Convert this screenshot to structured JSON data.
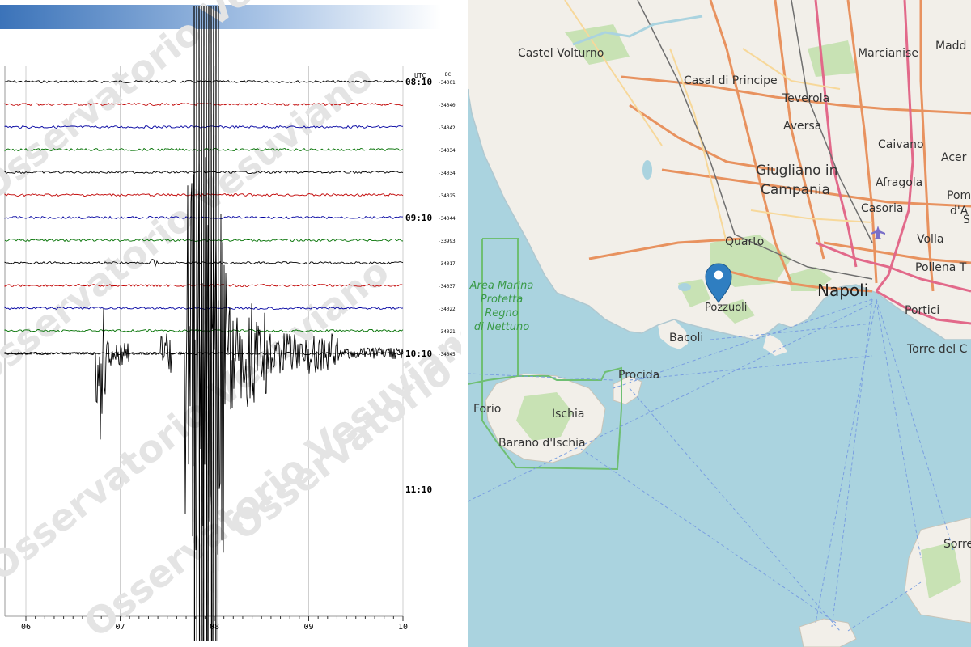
{
  "seismogram": {
    "utc_label": "UTC",
    "dc_label": "DC",
    "hour_labels": [
      "08:10",
      "09:10",
      "10:10",
      "11:10"
    ],
    "x_ticks": [
      "06",
      "07",
      "08",
      "09",
      "10"
    ],
    "dc_values": [
      "-34001",
      "-34040",
      "-34042",
      "-34034",
      "-34034",
      "-34025",
      "-34044",
      "-33993",
      "-34017",
      "-34037",
      "-34022",
      "-34021",
      "-34045"
    ],
    "trace_colors": [
      "#000000",
      "#c00000",
      "#0000a0",
      "#007000"
    ],
    "watermark": "Osservatorio Vesuviano"
  },
  "map": {
    "places": [
      "Castel Volturno",
      "Marcianise",
      "Madd",
      "Casal di Principe",
      "Teverola",
      "Aversa",
      "Caivano",
      "Acer",
      "Giugliano in",
      "Campania",
      "Afragola",
      "Pomi",
      "d'A",
      "Casoria",
      "Quarto",
      "Volla",
      "Pollena T",
      "Napoli",
      "Pozzuoli",
      "Portici",
      "Bacoli",
      "Torre del C",
      "Procida",
      "Forio",
      "Ischia",
      "Barano d'Ischia",
      "Sorre",
      "S"
    ],
    "marine_area": [
      "Area Marina",
      "Protetta",
      "Regno",
      "di Nettuno"
    ],
    "marker": "epicenter-pin"
  }
}
